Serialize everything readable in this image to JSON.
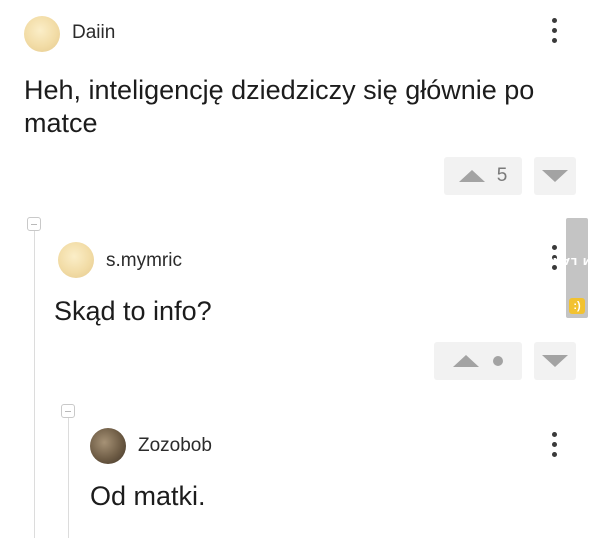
{
  "comments": [
    {
      "username": "Daiin",
      "text": "Heh, inteligencję dziedziczy się głównie po matce",
      "score": "5"
    },
    {
      "username": "s.mymric",
      "text": "Skąd to info?",
      "score_indicator": "dot"
    },
    {
      "username": "Zozobob",
      "text": "Od matki."
    }
  ],
  "watermark": {
    "text": "MEM LAND",
    "icon": "smiley-icon",
    "color": "#c4c4c4",
    "accent": "#f2c230"
  },
  "icons": {
    "menu": "more-vertical-icon",
    "upvote": "triangle-up-icon",
    "downvote": "triangle-down-icon",
    "collapse": "collapse-minus-icon"
  }
}
